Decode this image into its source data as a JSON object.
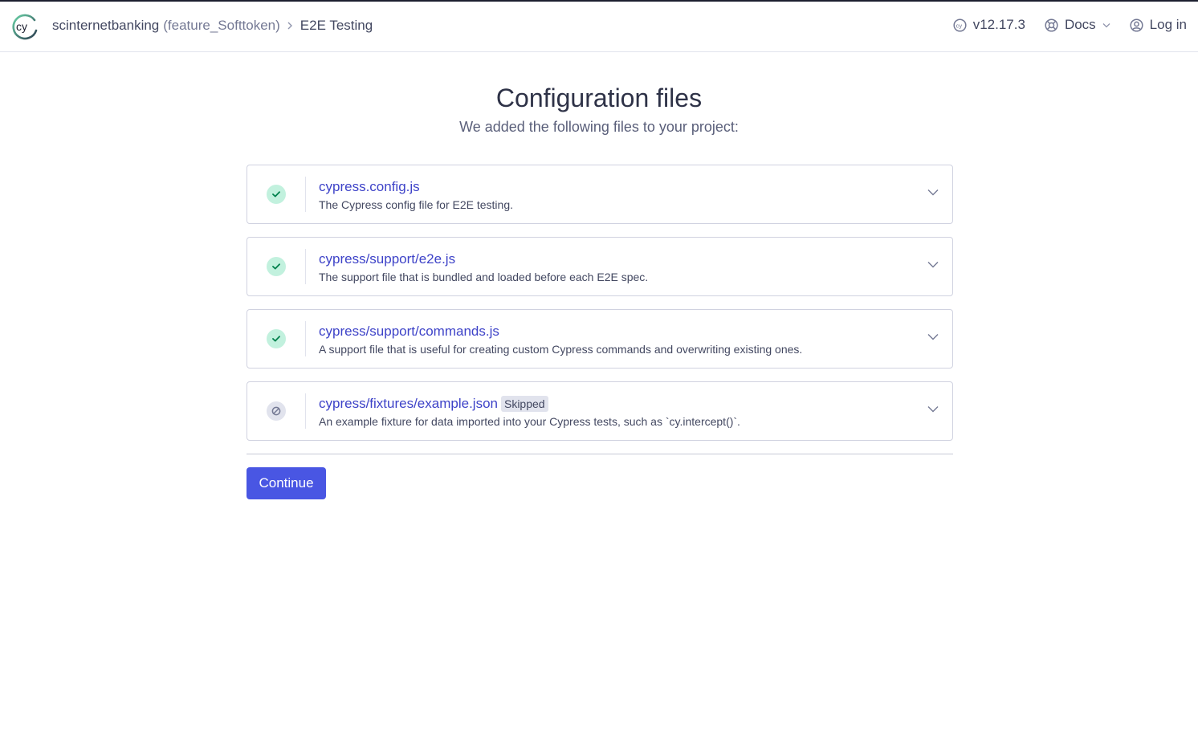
{
  "header": {
    "project": "scinternetbanking",
    "branch": "(feature_Softtoken)",
    "current": "E2E Testing",
    "version": "v12.17.3",
    "docs_label": "Docs",
    "login_label": "Log in"
  },
  "main": {
    "title": "Configuration files",
    "subtitle": "We added the following files to your project:",
    "files": [
      {
        "name": "cypress.config.js",
        "description": "The Cypress config file for E2E testing.",
        "status": "added"
      },
      {
        "name": "cypress/support/e2e.js",
        "description": "The support file that is bundled and loaded before each E2E spec.",
        "status": "added"
      },
      {
        "name": "cypress/support/commands.js",
        "description": "A support file that is useful for creating custom Cypress commands and overwriting existing ones.",
        "status": "added"
      },
      {
        "name": "cypress/fixtures/example.json",
        "badge": "Skipped",
        "description": "An example fixture for data imported into your Cypress tests, such as `cy.intercept()`.",
        "status": "skipped"
      }
    ],
    "continue_label": "Continue"
  },
  "icons": {
    "logo": "cypress-logo-icon",
    "breadcrumb_separator": "chevron-right-icon",
    "version": "cypress-cy-icon",
    "docs": "lifebuoy-icon",
    "login": "user-circle-icon",
    "added": "check-icon",
    "skipped": "prohibited-icon",
    "expand": "chevron-down-icon"
  },
  "colors": {
    "accent": "#4956e3",
    "link": "#3e43c8",
    "success_bg": "#c2f1de",
    "success_fg": "#00814d"
  }
}
